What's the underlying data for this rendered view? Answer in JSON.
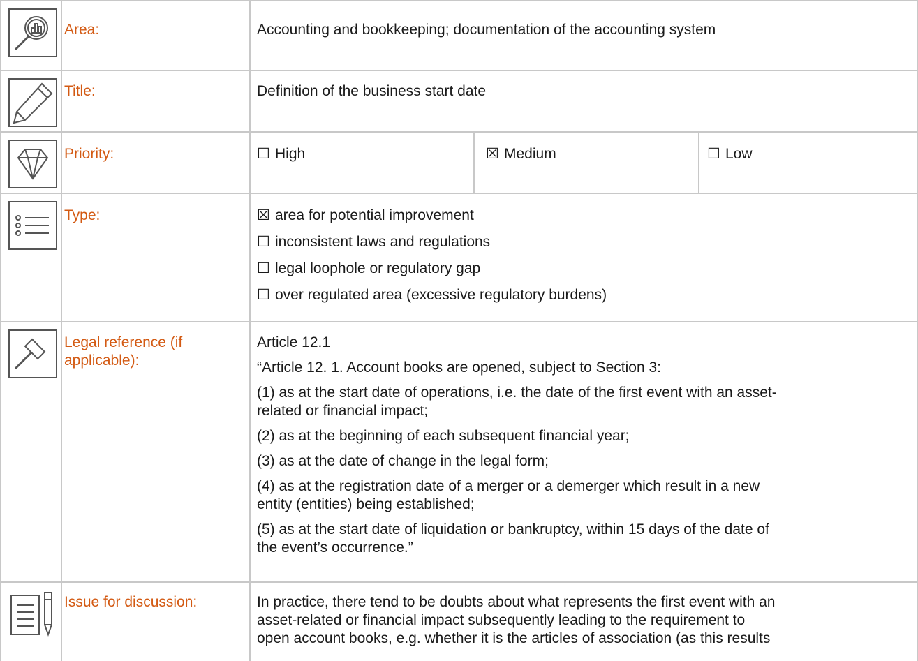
{
  "rows": {
    "area": {
      "label": "Area:",
      "value": "Accounting and bookkeeping; documentation of the accounting system"
    },
    "title": {
      "label": "Title:",
      "value": "Definition of the business start date"
    },
    "priority": {
      "label": "Priority:",
      "options": [
        {
          "box": "☐",
          "text": "High"
        },
        {
          "box": "☒",
          "text": "Medium"
        },
        {
          "box": "☐",
          "text": "Low"
        }
      ]
    },
    "type": {
      "label": "Type:",
      "options": [
        {
          "box": "☒",
          "text": "area for potential improvement"
        },
        {
          "box": "☐",
          "text": "inconsistent laws and regulations"
        },
        {
          "box": "☐",
          "text": "legal loophole or regulatory gap"
        },
        {
          "box": "☐",
          "text": "over regulated area (excessive regulatory burdens)"
        }
      ]
    },
    "legal": {
      "label_line1": "Legal reference (if",
      "label_line2": "applicable):",
      "lines": [
        "Article 12.1",
        "“Article 12. 1. Account books are opened, subject to Section 3:",
        "(1) as at the start date of operations, i.e. the date of the first event with an asset-",
        "related or financial impact;",
        "(2) as at the beginning of each subsequent financial year;",
        "(3) as at the date of change in the legal form;",
        "(4) as at the registration date of a merger or a demerger which result in a new",
        "entity (entities) being established;",
        "(5) as at the start date of liquidation or bankruptcy, within 15 days of the date of",
        "the event’s occurrence.”"
      ]
    },
    "issue": {
      "label": "Issue for discussion:",
      "lines": [
        "In practice, there tend to be doubts about what represents the first event with an",
        "asset-related or financial impact subsequently leading to the requirement to",
        "open account books, e.g. whether it is the articles of association (as this results"
      ]
    }
  },
  "icons": [
    "magnifier-chart-icon",
    "pencil-icon",
    "diamond-icon",
    "list-icon",
    "gavel-icon",
    "document-pen-icon"
  ],
  "colors": {
    "label": "#d35a13",
    "border": "#c8c8c8",
    "icon": "#555555"
  }
}
